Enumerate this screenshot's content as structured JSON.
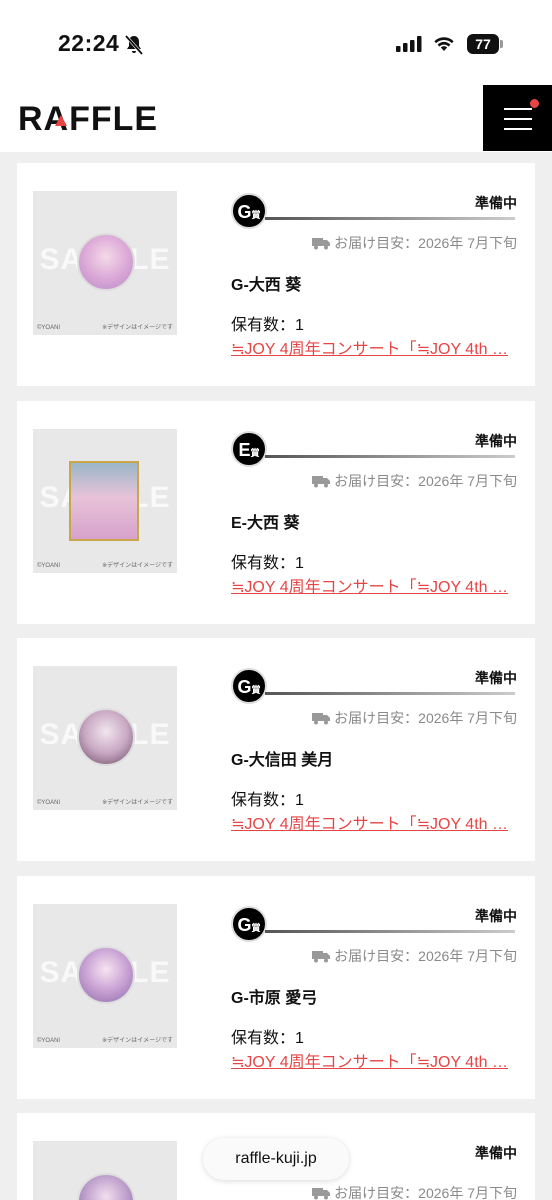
{
  "status_bar": {
    "time": "22:24",
    "battery": "77"
  },
  "header": {
    "logo": "RAFFLE"
  },
  "cards": [
    {
      "prize_letter": "G",
      "prize_kanji": "賞",
      "status": "準備中",
      "delivery": "お届け目安：2026年 7月下旬",
      "item_name": "G-大西 葵",
      "count": "保有数：1",
      "event": "≒JOY 4周年コンサート「≒JOY 4th …",
      "thumb_type": "badge",
      "sample_text": "SAMPLE",
      "copyright": "©YOANI",
      "design_note": "※デザインはイメージです"
    },
    {
      "prize_letter": "E",
      "prize_kanji": "賞",
      "status": "準備中",
      "delivery": "お届け目安：2026年 7月下旬",
      "item_name": "E-大西 葵",
      "count": "保有数：1",
      "event": "≒JOY 4周年コンサート「≒JOY 4th …",
      "thumb_type": "square",
      "sample_text": "SAMPLE",
      "copyright": "©YOANI",
      "design_note": "※デザインはイメージです"
    },
    {
      "prize_letter": "G",
      "prize_kanji": "賞",
      "status": "準備中",
      "delivery": "お届け目安：2026年 7月下旬",
      "item_name": "G-大信田 美月",
      "count": "保有数：1",
      "event": "≒JOY 4周年コンサート「≒JOY 4th …",
      "thumb_type": "badge",
      "sample_text": "SAMPLE",
      "copyright": "©YOANI",
      "design_note": "※デザインはイメージです"
    },
    {
      "prize_letter": "G",
      "prize_kanji": "賞",
      "status": "準備中",
      "delivery": "お届け目安：2026年 7月下旬",
      "item_name": "G-市原 愛弓",
      "count": "保有数：1",
      "event": "≒JOY 4周年コンサート「≒JOY 4th …",
      "thumb_type": "badge",
      "sample_text": "SAMPLE",
      "copyright": "©YOANI",
      "design_note": "※デザインはイメージです"
    },
    {
      "prize_letter": "",
      "prize_kanji": "",
      "status": "準備中",
      "delivery": "お届け目安：2026年 7月下旬",
      "item_name": "",
      "count": "",
      "event": "",
      "thumb_type": "badge",
      "sample_text": "",
      "copyright": "",
      "design_note": ""
    }
  ],
  "url_bar": {
    "url": "raffle-kuji.jp"
  },
  "colors": {
    "accent_red": "#e64545",
    "badge_black": "#000000",
    "page_bg": "#efefef"
  }
}
